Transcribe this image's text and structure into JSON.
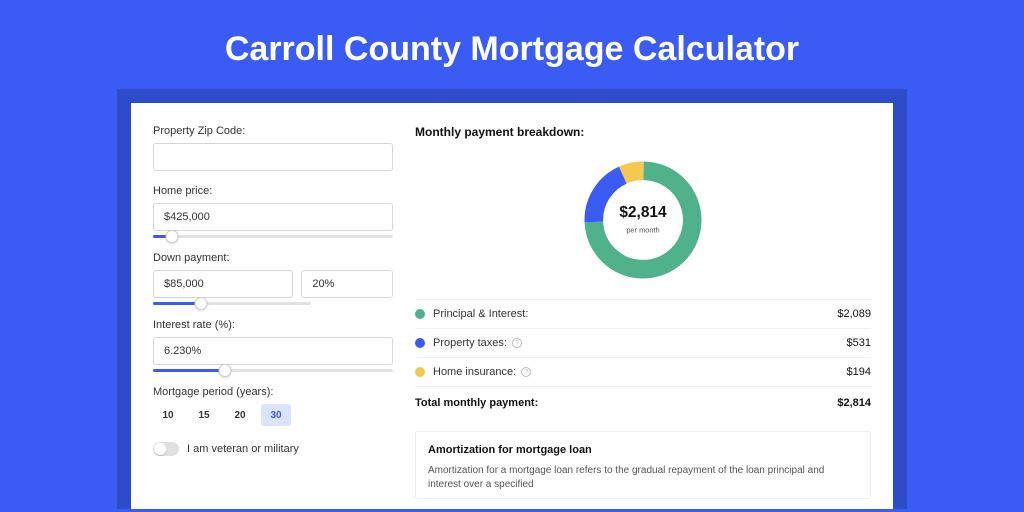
{
  "title": "Carroll County Mortgage Calculator",
  "form": {
    "zip_label": "Property Zip Code:",
    "zip_value": "",
    "home_price_label": "Home price:",
    "home_price_value": "$425,000",
    "down_payment_label": "Down payment:",
    "down_payment_value": "$85,000",
    "down_payment_pct": "20%",
    "interest_label": "Interest rate (%):",
    "interest_value": "6.230%",
    "period_label": "Mortgage period (years):",
    "period_options": [
      "10",
      "15",
      "20",
      "30"
    ],
    "period_selected": "30",
    "veteran_label": "I am veteran or military"
  },
  "breakdown": {
    "heading": "Monthly payment breakdown:",
    "center_amount": "$2,814",
    "center_sub": "per month",
    "rows": [
      {
        "label": "Principal & Interest:",
        "amount": "$2,089",
        "color": "green",
        "info": false
      },
      {
        "label": "Property taxes:",
        "amount": "$531",
        "color": "blue",
        "info": true
      },
      {
        "label": "Home insurance:",
        "amount": "$194",
        "color": "yellow",
        "info": true
      }
    ],
    "total_label": "Total monthly payment:",
    "total_amount": "$2,814"
  },
  "amort": {
    "heading": "Amortization for mortgage loan",
    "text": "Amortization for a mortgage loan refers to the gradual repayment of the loan principal and interest over a specified"
  },
  "chart_data": {
    "type": "pie",
    "title": "Monthly payment breakdown",
    "series": [
      {
        "name": "Principal & Interest",
        "value": 2089,
        "color": "#4fb28b"
      },
      {
        "name": "Property taxes",
        "value": 531,
        "color": "#3b5bf5"
      },
      {
        "name": "Home insurance",
        "value": 194,
        "color": "#f5c84f"
      }
    ],
    "total": 2814,
    "center_label": "$2,814 per month"
  }
}
